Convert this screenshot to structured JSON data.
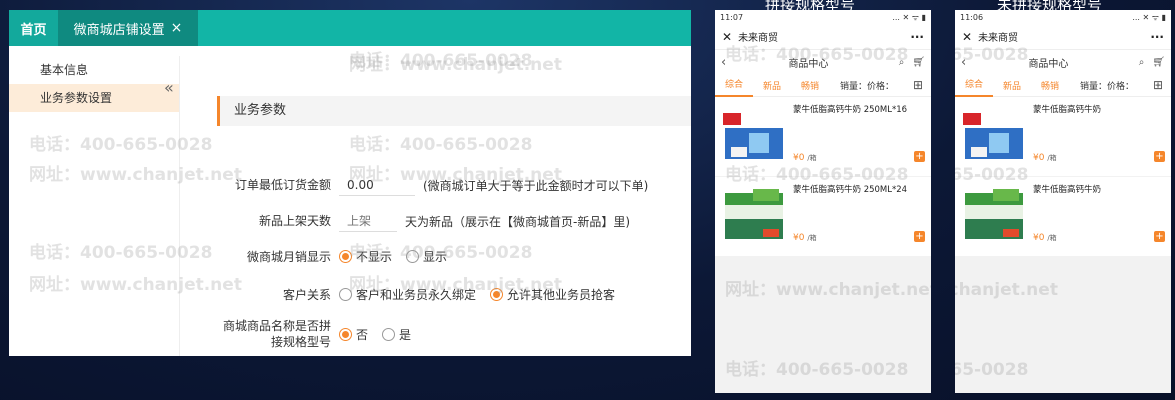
{
  "watermark": {
    "phone": "电话：400-665-0028",
    "url": "网址：www.chanjet.net"
  },
  "admin": {
    "tabs": {
      "home": "首页",
      "active": "微商城店铺设置",
      "close": "×"
    },
    "sidebar": {
      "items": [
        "基本信息",
        "业务参数设置"
      ],
      "collapse": "«"
    },
    "section_title": "业务参数",
    "fields": {
      "min_order": {
        "label": "订单最低订货金额",
        "value": "0.00",
        "hint": "(微商城订单大于等于此金额时才可以下单)"
      },
      "new_days": {
        "label": "新品上架天数",
        "placeholder": "上架",
        "hint": "天为新品（展示在【微商城首页-新品】里)"
      },
      "monthly_sales": {
        "label": "微商城月销显示",
        "options": [
          "不显示",
          "显示"
        ],
        "selected": 0
      },
      "customer_relation": {
        "label": "客户关系",
        "options": [
          "客户和业务员永久绑定",
          "允许其他业务员抢客"
        ],
        "selected": 1
      },
      "spec_concat": {
        "label": "商城商品名称是否拼接规格型号",
        "options": [
          "否",
          "是"
        ],
        "selected": 0
      }
    }
  },
  "phones": [
    {
      "caption": "拼接规格型号",
      "time": "11:07",
      "status_right": "... ✕ ᯤ ▮",
      "shop": "未来商贸",
      "page_title": "商品中心",
      "filters": [
        "综合",
        "新品",
        "畅销",
        "销量：价格："
      ],
      "products": [
        {
          "name": "蒙牛低脂高钙牛奶 250ML*16",
          "price": "¥0",
          "unit": "/箱"
        },
        {
          "name": "蒙牛低脂高钙牛奶 250ML*24",
          "price": "¥0",
          "unit": "/箱"
        }
      ]
    },
    {
      "caption": "未拼接规格型号",
      "time": "11:06",
      "status_right": "... ✕ ᯤ ▮",
      "shop": "未来商贸",
      "page_title": "商品中心",
      "filters": [
        "综合",
        "新品",
        "畅销",
        "销量：价格："
      ],
      "products": [
        {
          "name": "蒙牛低脂高钙牛奶",
          "price": "¥0",
          "unit": "/箱"
        },
        {
          "name": "蒙牛低脂高钙牛奶",
          "price": "¥0",
          "unit": "/箱"
        }
      ]
    }
  ]
}
